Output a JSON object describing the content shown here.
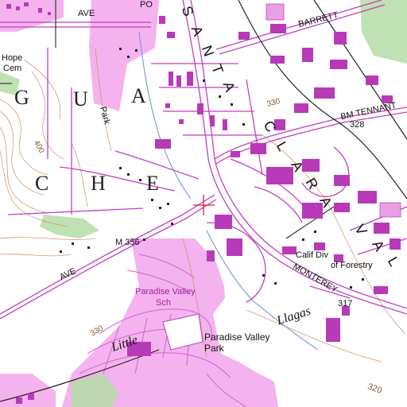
{
  "map": {
    "colors": {
      "urban_tint": "#f2a6ec",
      "building": "#b83ab8",
      "road_outline": "#c23fc0",
      "contour": "#c98a5a",
      "stream": "#6a8fd8",
      "vegetation": "#a6d89a",
      "boundary": "#2b2b2b"
    },
    "labels": {
      "hope_cem_line1": "Hope",
      "hope_cem_line2": "Cem",
      "ave_top": "AVE",
      "po": "PO",
      "barrett": "BARRETT",
      "bm_tennant": "BM TENNANT",
      "santa_s": "S",
      "santa_a1": "A",
      "santa_n": "N",
      "santa_t": "T",
      "santa_a2": "A",
      "clara_c": "C",
      "clara_l": "L",
      "clara_a1": "A",
      "clara_r": "R",
      "clara_a2": "A",
      "vall_v": "V",
      "vall_a": "A",
      "vall_l": "L",
      "guache_g": "G",
      "guache_u": "U",
      "guache_a": "A",
      "guache_c": "C",
      "guache_h": "H",
      "guache_e": "E",
      "park": "Park",
      "elev_330_top": "330",
      "elev_328": "328",
      "elev_400": "400",
      "bm_356": "M 356",
      "ave_bottom": "AVE",
      "paradise_valley_sch_line1": "Paradise Valley",
      "paradise_valley_sch_line2": "Sch",
      "calif_div_line1": "Calif Div",
      "calif_div_line2": "of Forestry",
      "monterey": "MONTEREY",
      "elev_317": "317",
      "llagas": "Llagas",
      "little": "Little",
      "elev_330_bottom": "330",
      "paradise_valley_park_line1": "Paradise Valley",
      "paradise_valley_park_line2": "Park",
      "elev_320": "320"
    },
    "icons": {
      "center_marker": "crosshair-marker"
    }
  }
}
